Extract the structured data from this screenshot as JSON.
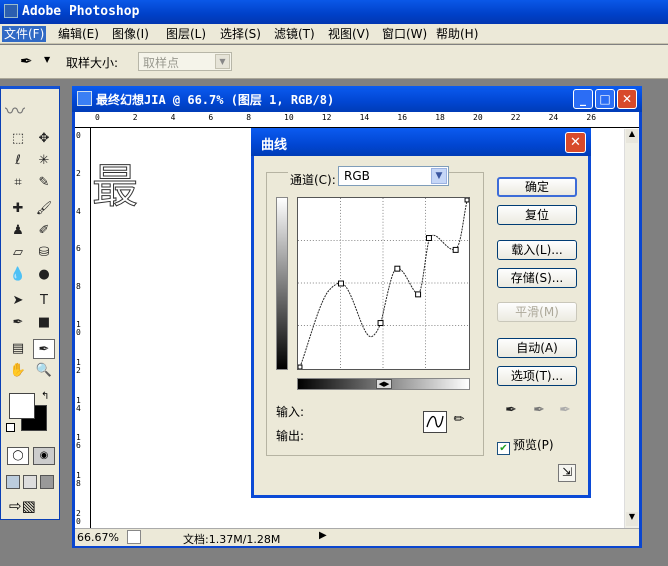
{
  "app": {
    "title": "Adobe Photoshop"
  },
  "menu": [
    "文件(F)",
    "编辑(E)",
    "图像(I)",
    "图层(L)",
    "选择(S)",
    "滤镜(T)",
    "视图(V)",
    "窗口(W)",
    "帮助(H)"
  ],
  "options_bar": {
    "sample_size_label": "取样大小:",
    "sample_size_value": "取样点"
  },
  "document": {
    "title": "最终幻想JIA @ 66.7% (图层 1, RGB/8)",
    "canvas_text": "最",
    "ruler_top": [
      "0",
      "2",
      "4",
      "6",
      "8",
      "10",
      "12",
      "14",
      "16",
      "18",
      "20",
      "22",
      "24",
      "26"
    ],
    "ruler_left": [
      "0",
      "2",
      "4",
      "6",
      "8",
      "1\n0",
      "1\n2",
      "1\n4",
      "1\n6",
      "1\n8",
      "2\n0"
    ],
    "status": {
      "zoom": "66.67%",
      "doc_info": "文档:1.37M/1.28M"
    }
  },
  "curves_dialog": {
    "title": "曲线",
    "channel_label": "通道(C):",
    "channel_value": "RGB",
    "input_label": "输入:",
    "output_label": "输出:",
    "buttons": {
      "ok": "确定",
      "reset": "复位",
      "load": "载入(L)...",
      "save": "存储(S)...",
      "smooth": "平滑(M)",
      "auto": "自动(A)",
      "options": "选项(T)..."
    },
    "preview_label": "预览(P)",
    "preview_checked": true
  }
}
